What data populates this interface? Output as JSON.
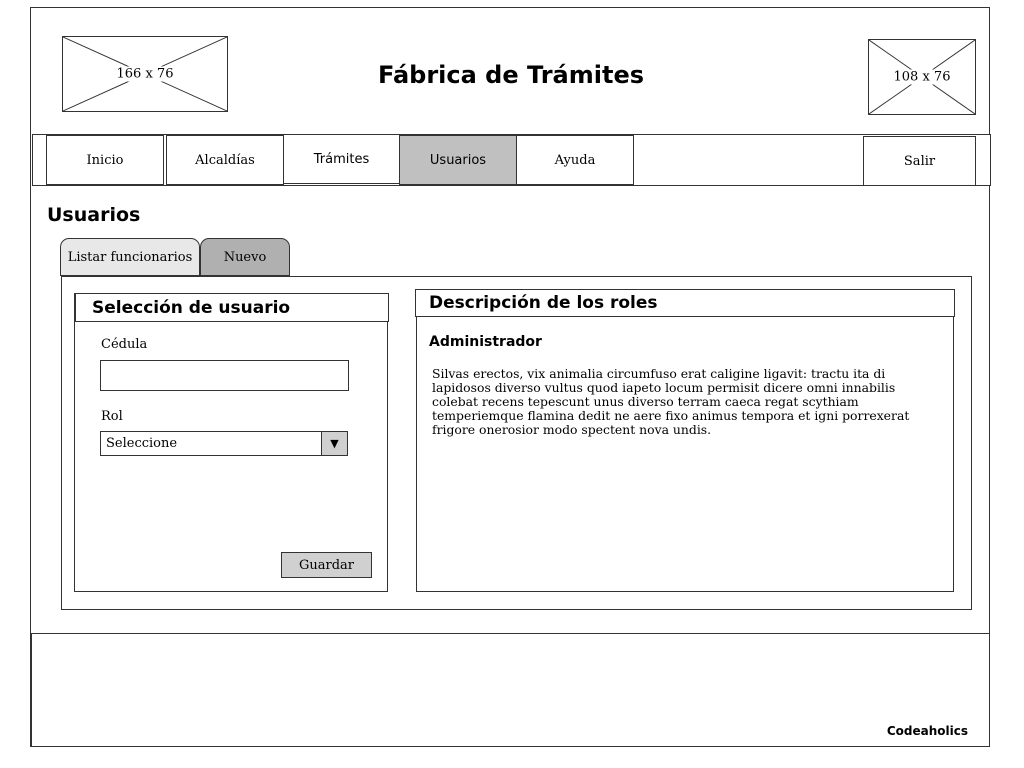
{
  "header": {
    "logo_left": {
      "label": "166 x 76"
    },
    "title": "Fábrica de Trámites",
    "logo_right": {
      "label": "108 x 76"
    }
  },
  "nav": {
    "items": [
      {
        "label": "Inicio"
      },
      {
        "label": "Alcaldías"
      },
      {
        "label": "Trámites"
      },
      {
        "label": "Usuarios"
      },
      {
        "label": "Ayuda"
      }
    ],
    "active": "Usuarios",
    "logout_label": "Salir"
  },
  "page": {
    "heading": "Usuarios",
    "tabs": [
      {
        "label": "Listar funcionarios"
      },
      {
        "label": "Nuevo"
      }
    ]
  },
  "user_selection": {
    "title": "Selección de usuario",
    "cedula_label": "Cédula",
    "cedula_value": "",
    "rol_label": "Rol",
    "rol_selected": "Seleccione",
    "save_label": "Guardar"
  },
  "roles_description": {
    "title": "Descripción de los roles",
    "role_name": "Administrador",
    "text": "Silvas erectos, vix animalia circumfuso erat caligine ligavit: tractu ita di lapidosos diverso vultus quod iapeto locum permisit dicere omni innabilis colebat recens tepescunt unus diverso terram caeca regat scythiam temperiemque flamina dedit ne aere fixo animus tempora et igni porrexerat frigore onerosior modo spectent nova undis."
  },
  "footer": {
    "brand": "Codeaholics"
  },
  "colors": {
    "active_nav": "#c0c0c0",
    "tab_list": "#e8e8e8",
    "tab_new": "#b0b0b0",
    "button": "#d0d0d0",
    "border": "#333333"
  }
}
